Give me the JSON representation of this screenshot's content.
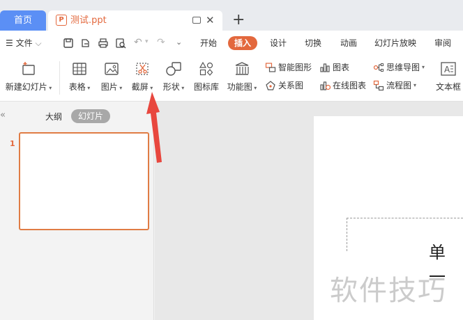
{
  "tabs": {
    "home_label": "首页",
    "file_name": "测试.ppt",
    "add_label": "+"
  },
  "menu": {
    "file_label": "文件",
    "tabs": [
      "开始",
      "插入",
      "设计",
      "切换",
      "动画",
      "幻灯片放映",
      "审阅"
    ],
    "active_tab": "插入"
  },
  "ribbon": {
    "new_slide": "新建幻灯片",
    "table": "表格",
    "picture": "图片",
    "screenshot": "截屏",
    "shape": "形状",
    "icon_library": "图标库",
    "function_chart": "功能图",
    "smart_graphic": "智能图形",
    "relation_chart": "关系图",
    "chart": "图表",
    "online_chart": "在线图表",
    "mind_map": "思维导图",
    "flowchart": "流程图",
    "textbox": "文本框"
  },
  "left_panel": {
    "outline_label": "大纲",
    "slides_label": "幻灯片",
    "slide_number": "1"
  },
  "slide": {
    "placeholder_text": "单 一"
  },
  "watermark": "软件技巧",
  "colors": {
    "accent": "#e3683d",
    "home_tab": "#5b8ff5",
    "arrow": "#e8473e"
  }
}
